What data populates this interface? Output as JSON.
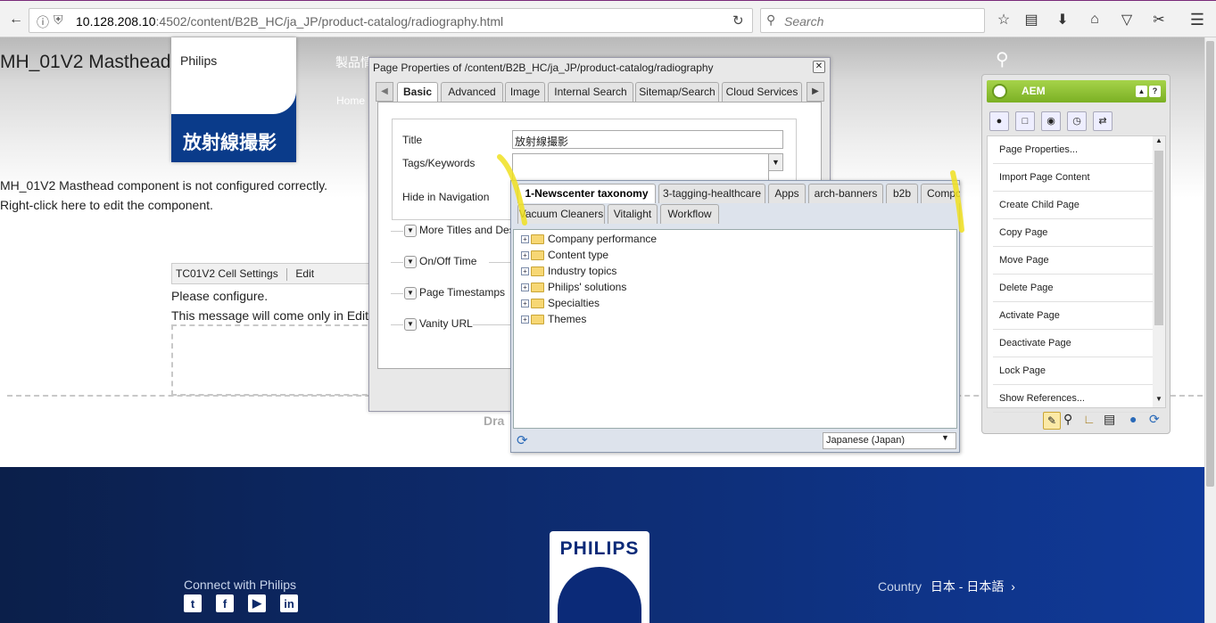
{
  "browser": {
    "url_host": "10.128.208.10",
    "url_rest": ":4502/content/B2B_HC/ja_JP/product-catalog/radiography.html",
    "search_placeholder": "Search"
  },
  "page": {
    "masthead_title": "MH_01V2 Masthead",
    "philips_label": "Philips",
    "hero_title": "放射線撮影",
    "nav_label": "製品情",
    "nav_home": "Home",
    "warning_line1": "MH_01V2 Masthead component is not configured correctly.",
    "warning_line2": "Right-click here to edit the component.",
    "cell_settings": "TC01V2 Cell Settings",
    "edit": "Edit",
    "configure_line1": "Please configure.",
    "configure_line2": "This message will come only in Edit m",
    "drag_text": "Dra"
  },
  "footer": {
    "connect": "Connect with Philips",
    "country_label": "Country",
    "country_value": "日本 - 日本語",
    "logo": "PHILIPS",
    "social_icons": [
      "twitter-icon",
      "facebook-icon",
      "youtube-icon",
      "linkedin-icon"
    ]
  },
  "page_properties": {
    "title": "Page Properties of /content/B2B_HC/ja_JP/product-catalog/radiography",
    "tabs": [
      "Basic",
      "Advanced",
      "Image",
      "Internal Search",
      "Sitemap/Search",
      "Cloud Services"
    ],
    "title_label": "Title",
    "title_value": "放射線撮影",
    "tags_label": "Tags/Keywords",
    "hide_nav_label": "Hide in Navigation",
    "sections": [
      "More Titles and Descr",
      "On/Off Time",
      "Page Timestamps",
      "Vanity URL"
    ]
  },
  "tag_picker": {
    "tabs_row1": [
      "1-Newscenter taxonomy",
      "3-tagging-healthcare",
      "Apps",
      "arch-banners",
      "b2b",
      "Compo"
    ],
    "tabs_row2": [
      "Vacuum Cleaners",
      "Vitalight",
      "Workflow"
    ],
    "tree": [
      "Company performance",
      "Content type",
      "Industry topics",
      "Philips' solutions",
      "Specialties",
      "Themes"
    ],
    "language": "Japanese (Japan)"
  },
  "sidekick": {
    "title": "AEM",
    "items": [
      "Page Properties...",
      "Import Page Content",
      "Create Child Page",
      "Copy Page",
      "Move Page",
      "Delete Page",
      "Activate Page",
      "Deactivate Page",
      "Lock Page",
      "Show References..."
    ]
  },
  "colors": {
    "aem_green": "#86b830",
    "footer_blue": "#0d2a6b",
    "highlight_yellow": "#f0e020"
  }
}
